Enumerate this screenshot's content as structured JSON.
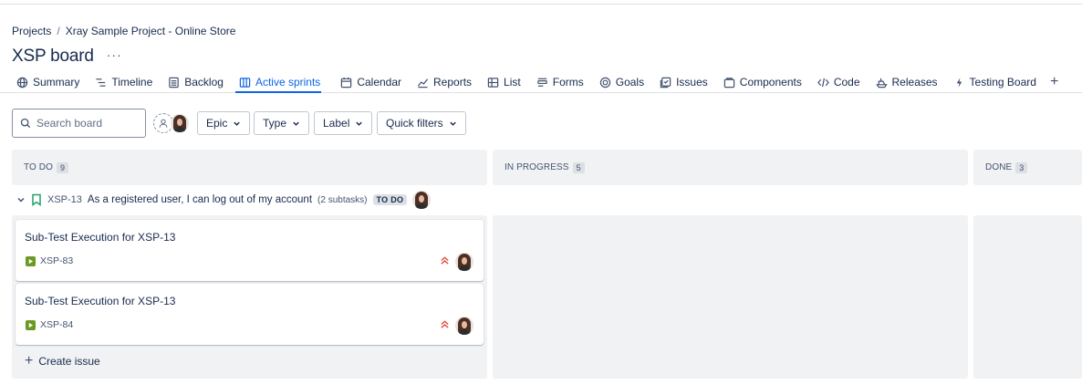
{
  "breadcrumb": {
    "root": "Projects",
    "separator": "/",
    "project": "Xray Sample Project - Online Store"
  },
  "board": {
    "title": "XSP board",
    "more": "···"
  },
  "tabs": [
    {
      "label": "Summary",
      "icon": "globe-icon"
    },
    {
      "label": "Timeline",
      "icon": "timeline-icon"
    },
    {
      "label": "Backlog",
      "icon": "backlog-icon"
    },
    {
      "label": "Active sprints",
      "icon": "board-icon",
      "active": true
    },
    {
      "label": "Calendar",
      "icon": "calendar-icon"
    },
    {
      "label": "Reports",
      "icon": "chart-icon"
    },
    {
      "label": "List",
      "icon": "list-icon"
    },
    {
      "label": "Forms",
      "icon": "forms-icon"
    },
    {
      "label": "Goals",
      "icon": "goals-icon"
    },
    {
      "label": "Issues",
      "icon": "issues-icon"
    },
    {
      "label": "Components",
      "icon": "components-icon"
    },
    {
      "label": "Code",
      "icon": "code-icon"
    },
    {
      "label": "Releases",
      "icon": "releases-icon"
    },
    {
      "label": "Testing Board",
      "icon": "lightning-icon"
    }
  ],
  "search": {
    "placeholder": "Search board",
    "value": ""
  },
  "filters": {
    "epic": "Epic",
    "type": "Type",
    "label": "Label",
    "quick": "Quick filters"
  },
  "columns": [
    {
      "name": "TO DO",
      "count": "9"
    },
    {
      "name": "IN PROGRESS",
      "count": "5"
    },
    {
      "name": "DONE",
      "count": "3"
    }
  ],
  "swimlane": {
    "key": "XSP-13",
    "summary": "As a registered user, I can log out of my account",
    "subtasks": "(2 subtasks)",
    "status": "TO DO"
  },
  "cards": [
    {
      "summary": "Sub-Test Execution for XSP-13",
      "key": "XSP-83",
      "priority": "highest"
    },
    {
      "summary": "Sub-Test Execution for XSP-13",
      "key": "XSP-84",
      "priority": "highest"
    }
  ],
  "create_issue": "Create issue",
  "colors": {
    "accent": "#0c66e4",
    "column_bg": "#f1f2f4",
    "priority": "#e2483d",
    "issue_type": "#6a9a23"
  }
}
